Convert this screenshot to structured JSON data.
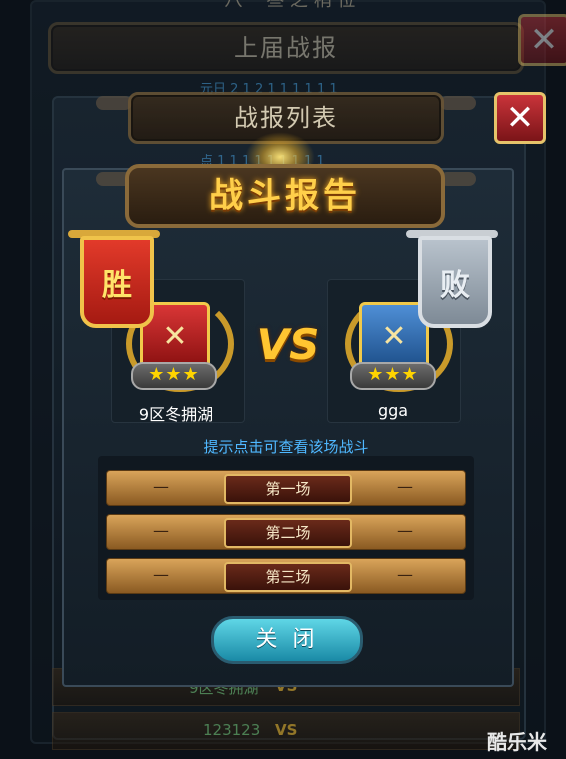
{
  "background": {
    "top_title": "八一 叁 之 稍 位",
    "previous_report_title": "上届战报",
    "report_list_title": "战报列表",
    "faded_line_1": "元日 2 1 2 1 1 1 1 1 1",
    "faded_line_2": "点 1 1 1 1 1 1 1 1 1"
  },
  "dialog": {
    "title": "战斗报告",
    "vs_label": "VS",
    "hint": "提示点击可查看该场战斗",
    "close_button": "关 闭"
  },
  "left_player": {
    "name": "9区冬拥湖",
    "result": "胜",
    "stars_text": "★★★",
    "stars": 3
  },
  "right_player": {
    "name": "gga",
    "result": "败",
    "stars_text": "★★★",
    "stars": 3
  },
  "battles": [
    {
      "label": "第一场",
      "left": "—",
      "right": "—"
    },
    {
      "label": "第二场",
      "left": "—",
      "right": "—"
    },
    {
      "label": "第三场",
      "left": "—",
      "right": "—"
    }
  ],
  "list_behind": [
    {
      "left": "9区冬拥湖",
      "vs": "VS"
    },
    {
      "left": "123123",
      "vs": "VS"
    }
  ],
  "watermark": "酷乐米",
  "colors": {
    "title_gold": "#ffcf4a",
    "hint_blue": "#4fb8ff",
    "close_teal": "#1a8aa6",
    "win_red": "#e23a2a",
    "lose_silver": "#b8c2cc"
  }
}
